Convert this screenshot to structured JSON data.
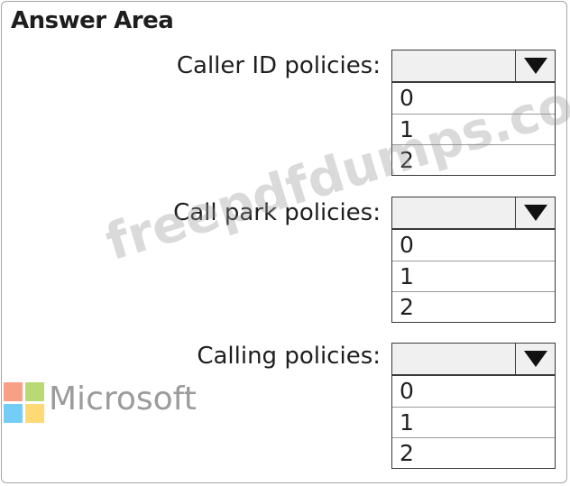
{
  "title": "Answer Area",
  "watermark": "freepdfdumps.com",
  "brand": {
    "name": "Microsoft"
  },
  "questions": [
    {
      "label": "Caller ID policies:",
      "selected": "",
      "options": [
        "0",
        "1",
        "2"
      ]
    },
    {
      "label": "Call park policies:",
      "selected": "",
      "options": [
        "0",
        "1",
        "2"
      ]
    },
    {
      "label": "Calling policies:",
      "selected": "",
      "options": [
        "0",
        "1",
        "2"
      ]
    }
  ]
}
